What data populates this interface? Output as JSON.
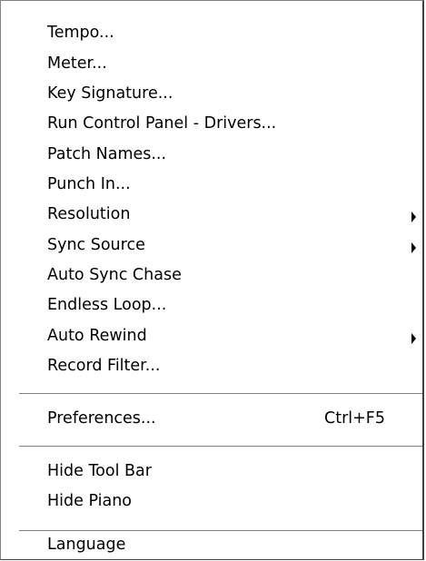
{
  "menu": {
    "items": [
      {
        "label": "Tempo..."
      },
      {
        "label": "Meter..."
      },
      {
        "label": "Key Signature..."
      },
      {
        "label": "Run Control Panel - Drivers..."
      },
      {
        "label": "Patch Names..."
      },
      {
        "label": "Punch In..."
      },
      {
        "label": "Resolution",
        "has_submenu": true
      },
      {
        "label": "Sync Source",
        "has_submenu": true
      },
      {
        "label": "Auto Sync Chase"
      },
      {
        "label": "Endless Loop..."
      },
      {
        "label": "Auto Rewind",
        "has_submenu": true
      },
      {
        "label": "Record Filter..."
      },
      {
        "label": "Preferences...",
        "shortcut": "Ctrl+F5"
      },
      {
        "label": "Hide Tool Bar"
      },
      {
        "label": "Hide Piano"
      },
      {
        "label": "Language"
      }
    ],
    "icons": {
      "submenu_arrow": "submenu-arrow-icon"
    }
  }
}
